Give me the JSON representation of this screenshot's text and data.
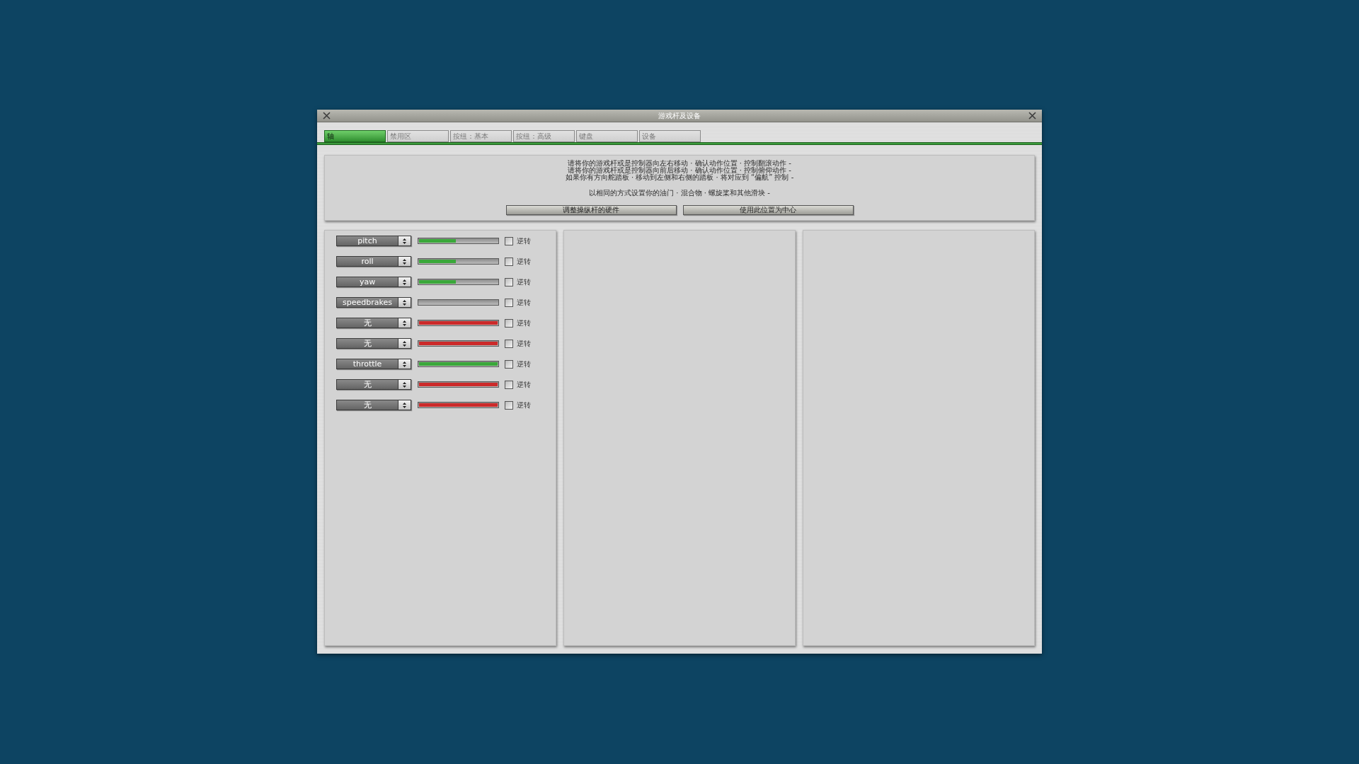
{
  "window": {
    "title": "游戏杆及设备"
  },
  "tabs": [
    {
      "label": "轴",
      "selected": true
    },
    {
      "label": "禁用区",
      "selected": false
    },
    {
      "label": "按纽：基本",
      "selected": false
    },
    {
      "label": "按纽：高级",
      "selected": false
    },
    {
      "label": "键盘",
      "selected": false
    },
    {
      "label": "设备",
      "selected": false
    }
  ],
  "instructions": {
    "lines": [
      "请将你的游戏杆或是控制器向左右移动 · 确认动作位置 · 控制翻滚动作 -",
      "请将你的游戏杆或是控制器向前后移动 · 确认动作位置 · 控制俯仰动作 -",
      "如果你有方向舵踏板 · 移动到左侧和右侧的踏板 · 将对应到 “偏航” 控制 -"
    ],
    "note": "以相同的方式设置你的油门 · 混合物 · 螺旋桨和其他滑块 -"
  },
  "buttons": [
    "调整操纵杆的硬件",
    "使用此位置为中心"
  ],
  "axes": [
    {
      "assignment": "pitch",
      "level": 0.47,
      "color": "#3aa83a",
      "checked": false,
      "reverse_label": "逆转"
    },
    {
      "assignment": "roll",
      "level": 0.47,
      "color": "#3aa83a",
      "checked": false,
      "reverse_label": "逆转"
    },
    {
      "assignment": "yaw",
      "level": 0.47,
      "color": "#3aa83a",
      "checked": false,
      "reverse_label": "逆转"
    },
    {
      "assignment": "speedbrakes",
      "checked": false,
      "reverse_label": "逆转"
    },
    {
      "assignment": "无",
      "level": 1,
      "color": "#cc2a2a",
      "checked": false,
      "reverse_label": "逆转"
    },
    {
      "assignment": "无",
      "level": 1,
      "color": "#cc2a2a",
      "checked": false,
      "reverse_label": "逆转"
    },
    {
      "assignment": "throttle",
      "level": 1,
      "color": "#3aa83a",
      "checked": false,
      "reverse_label": "逆转"
    },
    {
      "assignment": "无",
      "level": 1,
      "color": "#cc2a2a",
      "checked": false,
      "reverse_label": "逆转"
    },
    {
      "assignment": "无",
      "level": 1,
      "color": "#cc2a2a",
      "checked": false,
      "reverse_label": "逆转"
    }
  ]
}
